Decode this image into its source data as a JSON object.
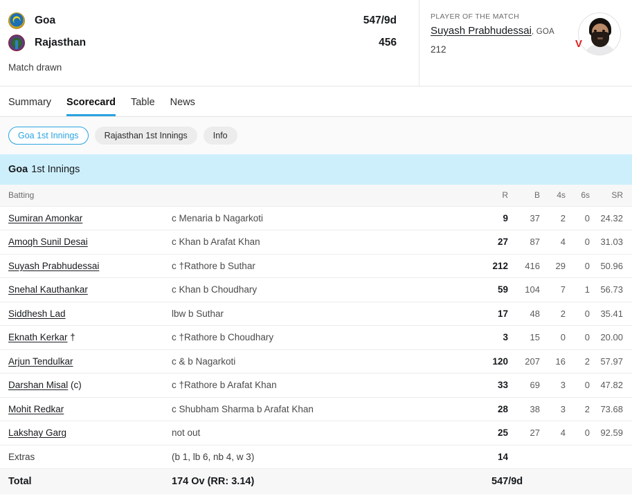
{
  "match": {
    "teams": [
      {
        "name": "Goa",
        "score": "547/9d",
        "logo": "goa-crest-icon"
      },
      {
        "name": "Rajasthan",
        "score": "456",
        "logo": "rajasthan-crest-icon"
      }
    ],
    "result": "Match drawn"
  },
  "player_of_the_match": {
    "label": "PLAYER OF THE MATCH",
    "name": "Suyash Prabhudessai",
    "team": ", GOA",
    "performance": "212",
    "badge": "V"
  },
  "nav_tabs": [
    {
      "label": "Summary",
      "active": false
    },
    {
      "label": "Scorecard",
      "active": true
    },
    {
      "label": "Table",
      "active": false
    },
    {
      "label": "News",
      "active": false
    }
  ],
  "innings_pills": [
    {
      "label": "Goa 1st Innings",
      "active": true
    },
    {
      "label": "Rajasthan 1st Innings",
      "active": false
    },
    {
      "label": "Info",
      "active": false
    }
  ],
  "innings": {
    "team": "Goa",
    "label": "1st Innings"
  },
  "table": {
    "headers": {
      "batting": "Batting",
      "r": "R",
      "b": "B",
      "fours": "4s",
      "sixes": "6s",
      "sr": "SR"
    },
    "rows": [
      {
        "batter": "Sumiran Amonkar",
        "suffix": "",
        "dismissal": "c Menaria b Nagarkoti",
        "r": "9",
        "b": "37",
        "fours": "2",
        "sixes": "0",
        "sr": "24.32"
      },
      {
        "batter": "Amogh Sunil Desai",
        "suffix": "",
        "dismissal": "c Khan b Arafat Khan",
        "r": "27",
        "b": "87",
        "fours": "4",
        "sixes": "0",
        "sr": "31.03"
      },
      {
        "batter": "Suyash Prabhudessai",
        "suffix": "",
        "dismissal": "c †Rathore b Suthar",
        "r": "212",
        "b": "416",
        "fours": "29",
        "sixes": "0",
        "sr": "50.96"
      },
      {
        "batter": "Snehal Kauthankar",
        "suffix": "",
        "dismissal": "c Khan b Choudhary",
        "r": "59",
        "b": "104",
        "fours": "7",
        "sixes": "1",
        "sr": "56.73"
      },
      {
        "batter": "Siddhesh Lad",
        "suffix": "",
        "dismissal": "lbw b Suthar",
        "r": "17",
        "b": "48",
        "fours": "2",
        "sixes": "0",
        "sr": "35.41"
      },
      {
        "batter": "Eknath Kerkar",
        "suffix": " †",
        "dismissal": "c †Rathore b Choudhary",
        "r": "3",
        "b": "15",
        "fours": "0",
        "sixes": "0",
        "sr": "20.00"
      },
      {
        "batter": "Arjun Tendulkar",
        "suffix": "",
        "dismissal": "c & b Nagarkoti",
        "r": "120",
        "b": "207",
        "fours": "16",
        "sixes": "2",
        "sr": "57.97"
      },
      {
        "batter": "Darshan Misal",
        "suffix": " (c)",
        "dismissal": "c †Rathore b Arafat Khan",
        "r": "33",
        "b": "69",
        "fours": "3",
        "sixes": "0",
        "sr": "47.82"
      },
      {
        "batter": "Mohit Redkar",
        "suffix": "",
        "dismissal": "c Shubham Sharma b Arafat Khan",
        "r": "28",
        "b": "38",
        "fours": "3",
        "sixes": "2",
        "sr": "73.68"
      },
      {
        "batter": "Lakshay Garg",
        "suffix": "",
        "dismissal": "not out",
        "r": "25",
        "b": "27",
        "fours": "4",
        "sixes": "0",
        "sr": "92.59"
      }
    ],
    "extras": {
      "label": "Extras",
      "detail": "(b 1, lb 6, nb 4, w 3)",
      "value": "14"
    },
    "total": {
      "label": "Total",
      "overs": "174 Ov (RR: 3.14)",
      "score": "547/9d"
    }
  },
  "colors": {
    "accent": "#2aa3e0",
    "innings_header_bg": "#cdeffc",
    "badge_red": "#e02020"
  }
}
